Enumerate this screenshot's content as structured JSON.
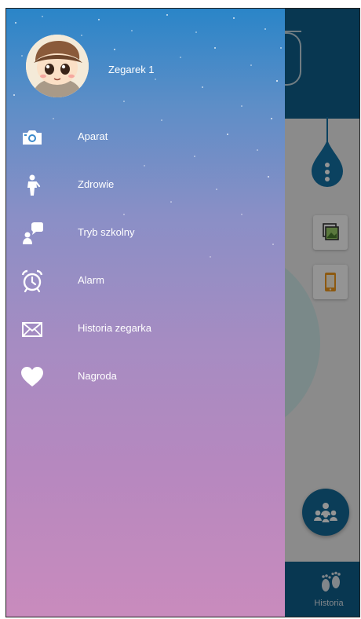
{
  "drawer": {
    "user": {
      "name": "Zegarek 1",
      "avatar_icon": "boy-avatar-icon"
    },
    "items": [
      {
        "label": "Aparat",
        "icon": "camera-icon"
      },
      {
        "label": "Zdrowie",
        "icon": "walking-person-icon"
      },
      {
        "label": "Tryb szkolny",
        "icon": "school-mode-icon"
      },
      {
        "label": "Alarm",
        "icon": "alarm-clock-icon"
      },
      {
        "label": "Historia zegarka",
        "icon": "envelope-icon"
      },
      {
        "label": "Nagroda",
        "icon": "heart-icon"
      }
    ]
  },
  "background": {
    "bottom_tab_label": "Historia",
    "colors": {
      "header": "#0e5f8c",
      "accent": "#136a98"
    }
  }
}
